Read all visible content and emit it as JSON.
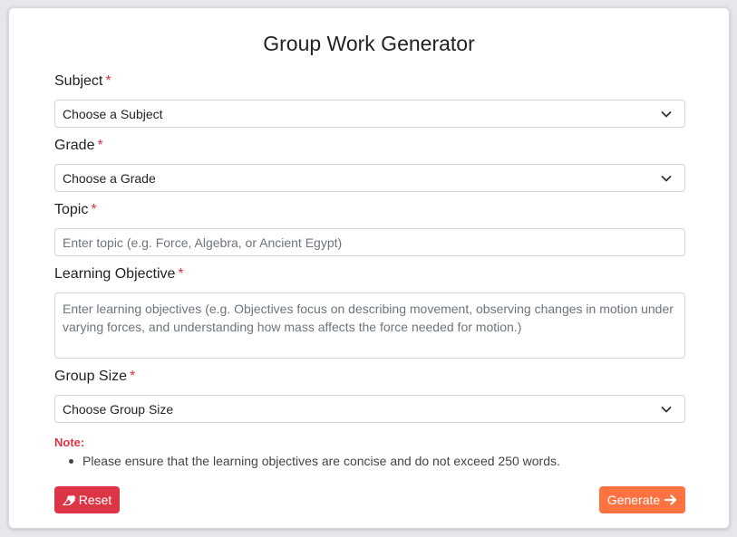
{
  "form": {
    "title": "Group Work Generator",
    "required_marker": "*",
    "subject": {
      "label": "Subject",
      "selected": "Choose a Subject"
    },
    "grade": {
      "label": "Grade",
      "selected": "Choose a Grade"
    },
    "topic": {
      "label": "Topic",
      "placeholder": "Enter topic (e.g. Force, Algebra, or Ancient Egypt)"
    },
    "learning_objective": {
      "label": "Learning Objective",
      "placeholder": "Enter learning objectives (e.g. Objectives focus on describing movement, observing changes in motion under varying forces, and understanding how mass affects the force needed for motion.)"
    },
    "group_size": {
      "label": "Group Size",
      "selected": "Choose Group Size"
    },
    "note": {
      "title": "Note:",
      "items": [
        "Please ensure that the learning objectives are concise and do not exceed 250 words."
      ]
    },
    "buttons": {
      "reset_label": "Reset",
      "reset_icon": "eraser-icon",
      "generate_label": "Generate",
      "generate_icon": "arrow-right-icon"
    }
  },
  "colors": {
    "required": "#dc3545",
    "reset": "#dc3545",
    "generate": "#fd7241"
  }
}
